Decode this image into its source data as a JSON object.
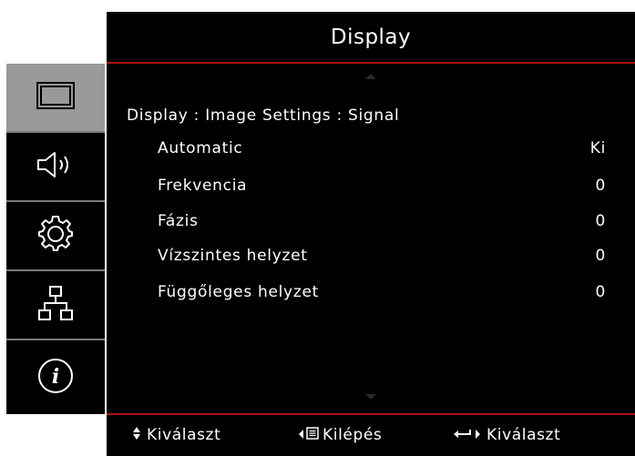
{
  "header": {
    "title": "Display"
  },
  "sidebar": {
    "tabs": [
      {
        "icon": "display-icon",
        "active": true
      },
      {
        "icon": "speaker-icon",
        "active": false
      },
      {
        "icon": "gear-icon",
        "active": false
      },
      {
        "icon": "network-icon",
        "active": false
      },
      {
        "icon": "info-icon",
        "active": false
      }
    ]
  },
  "main": {
    "breadcrumb": "Display : Image Settings : Signal",
    "rows": [
      {
        "label": "Automatic",
        "value": "Ki"
      },
      {
        "label": "Frekvencia",
        "value": "0"
      },
      {
        "label": "Fázis",
        "value": "0"
      },
      {
        "label": "Vízszintes helyzet",
        "value": "0"
      },
      {
        "label": "Függőleges helyzet",
        "value": "0"
      }
    ]
  },
  "footer": {
    "select_label": "Kiválaszt",
    "exit_label": "Kilépés",
    "enter_label": "Kiválaszt"
  },
  "colors": {
    "accent_line": "#b0120f",
    "active_tab": "#999999",
    "background": "#000000"
  }
}
